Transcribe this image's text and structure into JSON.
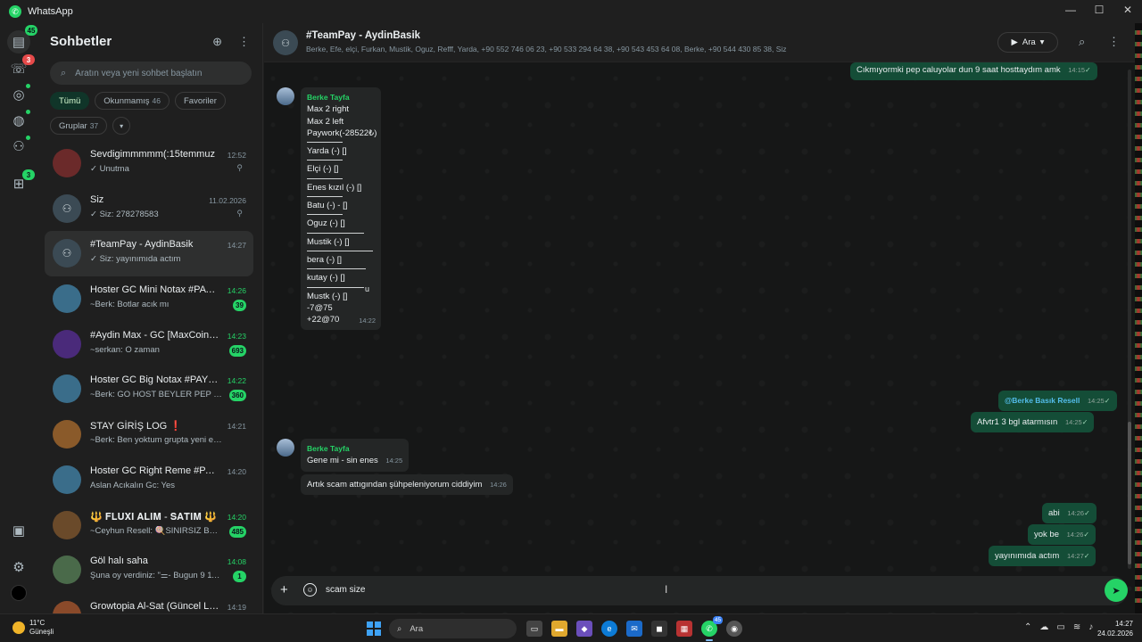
{
  "app": {
    "title": "WhatsApp"
  },
  "window": {
    "min": "—",
    "max": "☐",
    "close": "✕"
  },
  "rail": {
    "chats_badge": "45",
    "calls_badge": "3",
    "channels_badge": "3"
  },
  "sidebar": {
    "title": "Sohbetler",
    "search_placeholder": "Aratın veya yeni sohbet başlatın",
    "filters": [
      {
        "label": "Tümü",
        "count": ""
      },
      {
        "label": "Okunmamış",
        "count": "46"
      },
      {
        "label": "Favoriler",
        "count": ""
      },
      {
        "label": "Gruplar",
        "count": "37"
      }
    ],
    "chats": [
      {
        "name": "Sevdigimmmmm(:15temmuz",
        "time": "12:52",
        "preview": "✓ Unutma",
        "badge": "",
        "pinned": true
      },
      {
        "name": "Siz",
        "time": "11.02.2026",
        "preview": "✓ Siz: 278278583",
        "badge": "",
        "pinned": true
      },
      {
        "name": "#TeamPay - AydinBasik",
        "time": "14:27",
        "preview": "✓ Siz: yayınımıda actım",
        "badge": "",
        "pinned": false
      },
      {
        "name": "Hoster GC Mini Notax #PAYT...",
        "time": "14:26",
        "preview": "~Berk: Botlar acık mı",
        "badge": "39",
        "pinned": false
      },
      {
        "name": "#Aydin Max - GC [MaxCoin83]",
        "time": "14:23",
        "preview": "~serkan: O zaman",
        "badge": "693",
        "pinned": false
      },
      {
        "name": "Hoster GC Big Notax #PAYTO...",
        "time": "14:22",
        "preview": "~Berk: GO HOST BEYLER PEP VAR",
        "badge": "360",
        "pinned": false
      },
      {
        "name": "STAY GİRİŞ LOG ❗",
        "time": "14:21",
        "preview": "~Berk: Ben yoktum grupta yeni ekledıler",
        "badge": "",
        "pinned": false
      },
      {
        "name": "Hoster GC Right Reme #PAYT...",
        "time": "14:20",
        "preview": "Aslan Acıkalın Gc: Yes",
        "badge": "",
        "pinned": false
      },
      {
        "name": "🔱 𝐅𝐋𝐔𝐗𝐈 𝐀𝐋𝐈𝐌 - 𝐒𝐀𝐓𝐈𝐌 🔱",
        "time": "14:20",
        "preview": "~Ceyhun Resell: 🍭SINIRSIZ BGL...",
        "badge": "485",
        "pinned": false
      },
      {
        "name": "Göl halı saha",
        "time": "14:08",
        "preview": "Şuna oy verdiniz: \"⚌- Bugun 9 11 ha...",
        "badge": "1",
        "pinned": false
      },
      {
        "name": "Growtopia Al-Sat (Güncel Lin...",
        "time": "14:19",
        "preview": "",
        "badge": "",
        "pinned": false
      }
    ]
  },
  "header": {
    "group_name": "#TeamPay - AydinBasik",
    "members": "Berke, Efe, elçi, Furkan, Mustik, Oguz, Refff, Yarda, +90 552 746 06 23, +90 533 294 64 38, +90 543 453 64 08, Berke, +90 544 430 85 38, Siz",
    "call_label": "Ara"
  },
  "messages": {
    "m0": {
      "text": "Cıkmıyormki pep caluyolar dun 9 saat hosttaydım amk",
      "time": "14:15"
    },
    "m1": {
      "sender": "Berke Tayfa",
      "lines": [
        "Max 2 right",
        "Max 2 left",
        "Paywork(-28522₺)",
        "Yarda (-) []",
        "Elçi (-) []",
        "Enes kızıl (-) []",
        "Batu (-) - []",
        "Oguz (-) []",
        "Mustik (-) []",
        "bera (-) []",
        "kutay (-) []",
        "Mustk (-) []",
        "-7@75",
        "+22@70"
      ],
      "trail": "u",
      "time": "14:22"
    },
    "m2": {
      "text": "@Berke Basık Resell",
      "time": "14:25"
    },
    "m3": {
      "text": "Afvtr1 3 bgl atarmısın",
      "time": "14:25"
    },
    "m4": {
      "sender": "Berke Tayfa",
      "text": "Gene mi - sin enes",
      "time": "14:25"
    },
    "m5": {
      "text": "Artık scam attıgından şühpeleniyorum ciddiyim",
      "time": "14:26"
    },
    "m6": {
      "text": "abi",
      "time": "14:26"
    },
    "m7": {
      "text": "yok be",
      "time": "14:26"
    },
    "m8": {
      "text": "yayınımıda actım",
      "time": "14:27"
    }
  },
  "composer": {
    "value": "scam size"
  },
  "taskbar": {
    "temp": "11°C",
    "weather": "Güneşli",
    "search": "Ara",
    "wa_badge": "45",
    "time": "14:27",
    "date": "24.02.2026"
  },
  "colors": {
    "accent": "#25d366",
    "outgoing": "#144d37",
    "incoming": "#242626",
    "background": "#161717"
  }
}
